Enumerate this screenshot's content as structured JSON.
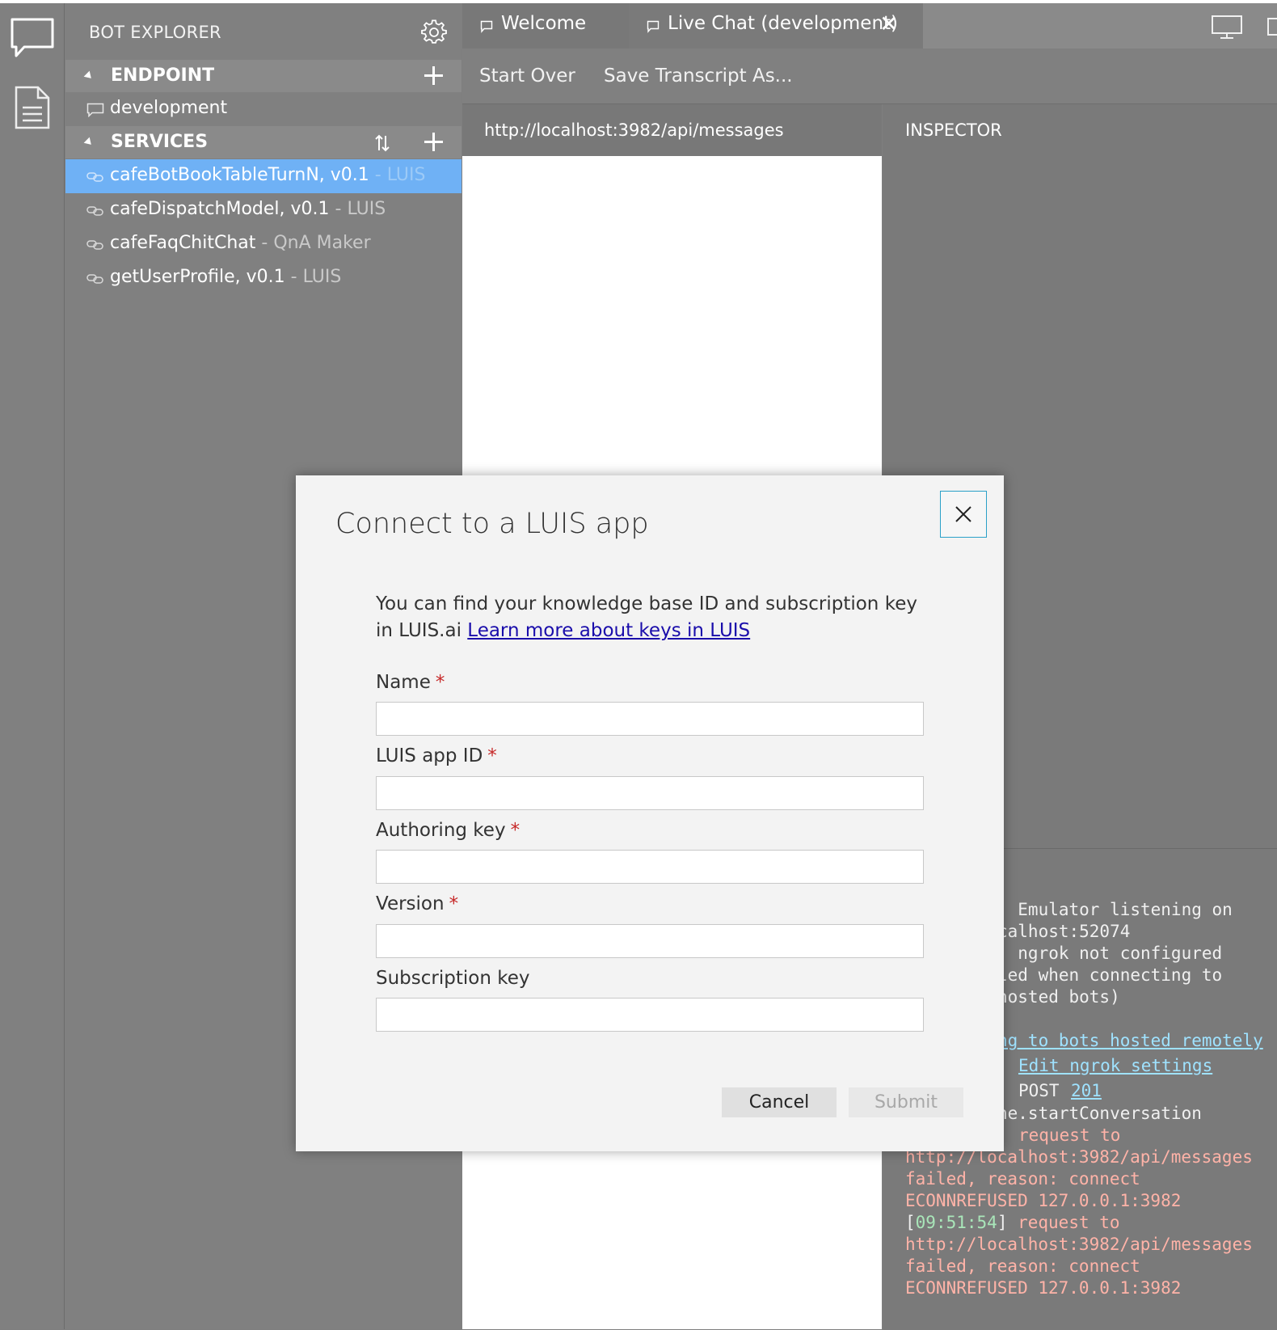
{
  "explorer": {
    "title": "BOT EXPLORER",
    "endpoint": {
      "label": "ENDPOINT",
      "items": [
        "development"
      ]
    },
    "services": {
      "label": "SERVICES",
      "items": [
        {
          "name": "cafeBotBookTableTurnN, v0.1",
          "tag": "- LUIS",
          "selected": true
        },
        {
          "name": "cafeDispatchModel, v0.1",
          "tag": "- LUIS"
        },
        {
          "name": "cafeFaqChitChat",
          "tag": "- QnA Maker"
        },
        {
          "name": "getUserProfile, v0.1",
          "tag": "- LUIS"
        }
      ]
    }
  },
  "tabs": [
    {
      "label": "Welcome"
    },
    {
      "label": "Live Chat (development)",
      "close": "✕"
    }
  ],
  "toolbar": {
    "start_over": "Start Over",
    "save_transcript": "Save Transcript As..."
  },
  "chat": {
    "url": "http://localhost:3982/api/messages"
  },
  "inspector": {
    "title": "INSPECTOR"
  },
  "log": {
    "line1": "] Emulator listening on",
    "line2": "calhost:52074",
    "line3": "] ngrok not configured",
    "line4": "led when connecting to",
    "line5": "hosted bots)",
    "link1": "ng to bots hosted remotely",
    "link2": "Edit ngrok settings",
    "post_method": "POST",
    "post_status": "201",
    "line8": "ne.startConversation",
    "err1": "request to",
    "err2": "http://localhost:3982/api/messages",
    "err3": "failed, reason: connect",
    "err4": "ECONNREFUSED 127.0.0.1:3982",
    "ts": "09:51:54",
    "err5": "request to",
    "err6": "http://localhost:3982/api/messages",
    "err7": "failed, reason: connect",
    "err8": "ECONNREFUSED 127.0.0.1:3982"
  },
  "dialog": {
    "title": "Connect to a LUIS app",
    "description": "You can find your knowledge base ID and subscription key in LUIS.ai",
    "learn_more": "Learn more about keys in LUIS",
    "fields": [
      {
        "label": "Name",
        "required": "*",
        "value": ""
      },
      {
        "label": "LUIS app ID",
        "required": "*",
        "value": ""
      },
      {
        "label": "Authoring key",
        "required": "*",
        "value": ""
      },
      {
        "label": "Version",
        "required": "*",
        "value": ""
      },
      {
        "label": "Subscription key",
        "value": ""
      }
    ],
    "cancel": "Cancel",
    "submit": "Submit"
  },
  "colors": {
    "selected": "#6fb1f5",
    "link": "#1a0dab",
    "log_error": "#ffb3a8",
    "log_link": "#9fe2ff",
    "required": "#c62828"
  }
}
